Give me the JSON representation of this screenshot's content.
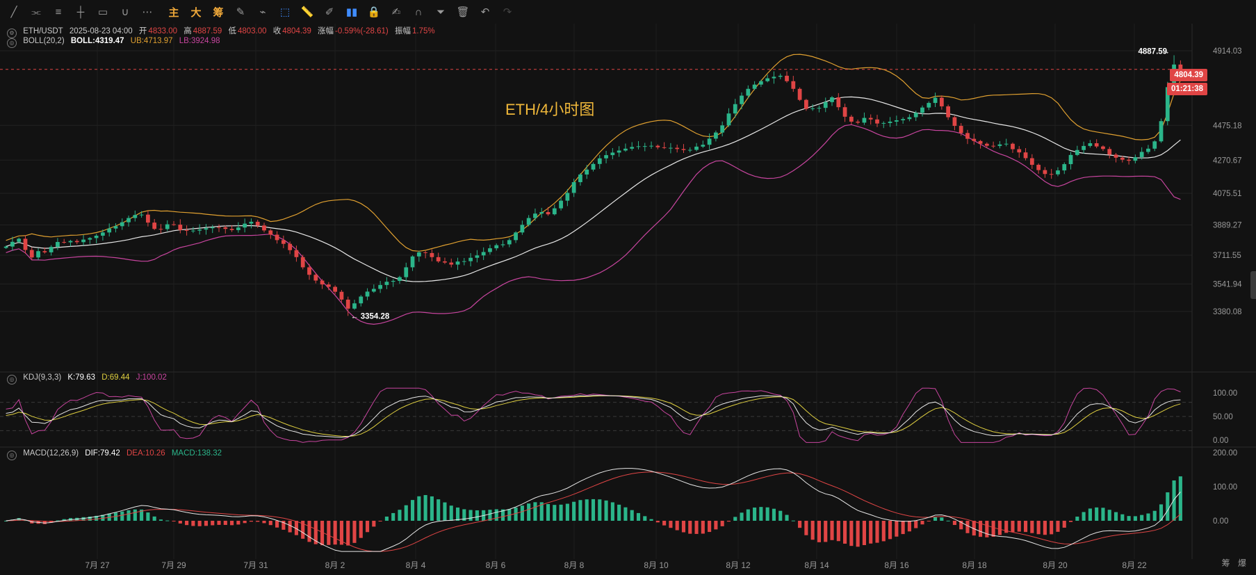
{
  "toolbar": {
    "tools": [
      {
        "name": "trend-line-icon",
        "glyph": "╱"
      },
      {
        "name": "parallel-channel-icon",
        "glyph": "⫘"
      },
      {
        "name": "horizontal-lines-icon",
        "glyph": "≡"
      },
      {
        "name": "cross-line-icon",
        "glyph": "┼"
      },
      {
        "name": "rectangle-icon",
        "glyph": "▭"
      },
      {
        "name": "curve-icon",
        "glyph": "∪"
      },
      {
        "name": "more-tools-icon",
        "glyph": "⋯"
      }
    ],
    "cn_buttons": [
      {
        "name": "main-chart-button",
        "label": "主"
      },
      {
        "name": "large-button",
        "label": "大"
      },
      {
        "name": "chips-button",
        "label": "筹"
      }
    ],
    "tools2": [
      {
        "name": "draw-brush-icon",
        "glyph": "✎"
      },
      {
        "name": "measure-icon",
        "glyph": "⌁"
      },
      {
        "name": "select-cursor-icon",
        "glyph": "⬚"
      },
      {
        "name": "ruler-icon",
        "glyph": "📏"
      },
      {
        "name": "pen-icon",
        "glyph": "✐"
      },
      {
        "name": "candle-type-icon",
        "glyph": "▮▮"
      },
      {
        "name": "lock-icon",
        "glyph": "🔒"
      },
      {
        "name": "edit-note-icon",
        "glyph": "✍"
      },
      {
        "name": "magnet-icon",
        "glyph": "∩"
      },
      {
        "name": "filter-icon",
        "glyph": "⏷"
      },
      {
        "name": "trash-icon",
        "glyph": "🗑"
      },
      {
        "name": "undo-icon",
        "glyph": "↶"
      },
      {
        "name": "redo-icon",
        "glyph": "↷"
      }
    ]
  },
  "ohlc": {
    "symbol": "ETH/USDT",
    "date": "2025-08-23 04:00",
    "open_label": "开",
    "open": "4833.00",
    "high_label": "高",
    "high": "4887.59",
    "low_label": "低",
    "low": "4803.00",
    "close_label": "收",
    "close": "4804.39",
    "change_label": "涨幅",
    "change": "-0.59%(-28.61)",
    "amplitude_label": "振幅",
    "amplitude": "1.75%"
  },
  "boll": {
    "name": "BOLL(20,2)",
    "mid": "BOLL:4319.47",
    "ub": "UB:4713.97",
    "lb": "LB:3924.98"
  },
  "kdj": {
    "name": "KDJ(9,3,3)",
    "k": "K:79.63",
    "d": "D:69.44",
    "j": "J:100.02"
  },
  "macd": {
    "name": "MACD(12,26,9)",
    "dif": "DIF:79.42",
    "dea": "DEA:10.26",
    "macd": "MACD:138.32"
  },
  "overlay_title": "ETH/4小时图",
  "price_tags": {
    "current": "4804.39",
    "countdown": "01:21:38"
  },
  "bottom_right": {
    "chips": "筹",
    "burst": "爆"
  },
  "colors": {
    "up": "#2bb58a",
    "down": "#e04545",
    "mid": "#e8e8e8",
    "ub": "#e0a030",
    "lb": "#c8459f",
    "k": "#e8e8e8",
    "d": "#e0d040",
    "j": "#c8459f",
    "dif": "#e8e8e8",
    "dea": "#e04545",
    "title": "#f0b83a"
  },
  "chart_data": {
    "type": "candlestick",
    "interval": "4h",
    "price_axis": [
      "4914.03",
      "4475.18",
      "4270.67",
      "4075.51",
      "3889.27",
      "3711.55",
      "3541.94",
      "3380.08"
    ],
    "kdj_axis": [
      "100.00",
      "50.00",
      "0.00"
    ],
    "macd_axis": [
      "200.00",
      "100.00",
      "0.00"
    ],
    "x_axis": [
      "7月 27",
      "7月 29",
      "7月 31",
      "8月 2",
      "8月 4",
      "8月 6",
      "8月 8",
      "8月 10",
      "8月 12",
      "8月 14",
      "8月 16",
      "8月 18",
      "8月 20",
      "8月 22"
    ],
    "annotations": [
      {
        "label": "4887.59",
        "type": "high"
      },
      {
        "label": "3354.28",
        "type": "low"
      }
    ],
    "closes": [
      3762,
      3790,
      3808,
      3742,
      3698,
      3735,
      3728,
      3760,
      3789,
      3787,
      3795,
      3788,
      3803,
      3812,
      3826,
      3845,
      3868,
      3882,
      3905,
      3930,
      3948,
      3950,
      3903,
      3866,
      3865,
      3893,
      3891,
      3859,
      3855,
      3856,
      3862,
      3870,
      3876,
      3875,
      3866,
      3859,
      3874,
      3897,
      3908,
      3886,
      3857,
      3832,
      3800,
      3778,
      3741,
      3700,
      3640,
      3596,
      3562,
      3539,
      3525,
      3496,
      3450,
      3397,
      3428,
      3468,
      3497,
      3513,
      3536,
      3555,
      3560,
      3582,
      3640,
      3704,
      3728,
      3724,
      3700,
      3675,
      3668,
      3656,
      3674,
      3676,
      3696,
      3710,
      3730,
      3752,
      3770,
      3775,
      3800,
      3845,
      3890,
      3930,
      3956,
      3965,
      3952,
      3987,
      4032,
      4078,
      4141,
      4186,
      4215,
      4248,
      4281,
      4300,
      4315,
      4327,
      4338,
      4348,
      4352,
      4353,
      4355,
      4346,
      4342,
      4343,
      4336,
      4330,
      4331,
      4350,
      4361,
      4397,
      4433,
      4475,
      4545,
      4600,
      4650,
      4690,
      4715,
      4735,
      4752,
      4761,
      4767,
      4735,
      4690,
      4625,
      4572,
      4575,
      4578,
      4612,
      4640,
      4582,
      4526,
      4497,
      4491,
      4519,
      4510,
      4486,
      4489,
      4497,
      4505,
      4512,
      4523,
      4549,
      4580,
      4607,
      4638,
      4587,
      4523,
      4472,
      4430,
      4396,
      4383,
      4367,
      4355,
      4354,
      4363,
      4367,
      4335,
      4316,
      4282,
      4243,
      4212,
      4189,
      4187,
      4210,
      4247,
      4301,
      4330,
      4354,
      4370,
      4351,
      4336,
      4303,
      4285,
      4273,
      4267,
      4288,
      4319,
      4338,
      4381,
      4500,
      4700,
      4833,
      4804
    ]
  }
}
